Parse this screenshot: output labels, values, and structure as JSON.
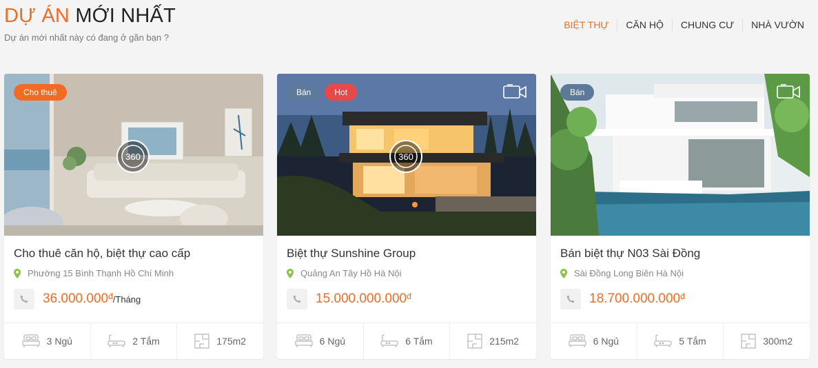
{
  "header": {
    "title_accent": "DỰ ÁN",
    "title_rest": "MỚI NHẤT",
    "subtitle": "Dự án mới nhất này có đang ở gần bạn ?"
  },
  "tabs": [
    {
      "label": "BIỆT THỰ",
      "active": true
    },
    {
      "label": "CĂN HỘ"
    },
    {
      "label": "CHUNG CƯ"
    },
    {
      "label": "NHÀ VƯỜN"
    }
  ],
  "cards": [
    {
      "badges": [
        "Cho thuê"
      ],
      "has_360": true,
      "has_video": false,
      "title": "Cho thuê căn hộ, biệt thự cao cấp",
      "location": "Phường 15 Bình Thạnh Hồ Chí Minh",
      "price": "36.000.000",
      "currency": "đ",
      "price_unit": "/Tháng",
      "beds": "3 Ngủ",
      "baths": "2 Tắm",
      "area": "175m2"
    },
    {
      "badges": [
        "Bán",
        "Hot"
      ],
      "has_360": true,
      "has_video": true,
      "title": "Biệt thự Sunshine Group",
      "location": "Quảng An Tây Hồ Hà Nội",
      "price": "15.000.000.000",
      "currency": "đ",
      "price_unit": "",
      "beds": "6 Ngủ",
      "baths": "6 Tắm",
      "area": "215m2"
    },
    {
      "badges": [
        "Bán"
      ],
      "has_360": false,
      "has_video": true,
      "title": "Bán biệt thự N03 Sài Đồng",
      "location": "Sài Đồng Long Biên Hà Nội",
      "price": "18.700.000.000",
      "currency": "đ",
      "price_unit": "",
      "beds": "6 Ngủ",
      "baths": "5 Tắm",
      "area": "300m2"
    }
  ],
  "colors": {
    "accent": "#f26b22",
    "badge_rent": "#f26b22",
    "badge_sale": "#5e7a9a",
    "badge_hot": "#e84848",
    "pin": "#8bc34a"
  },
  "icons": [
    "video-icon",
    "pano-360-icon",
    "map-pin-icon",
    "phone-icon",
    "bed-icon",
    "bathtub-icon",
    "floorplan-icon"
  ]
}
